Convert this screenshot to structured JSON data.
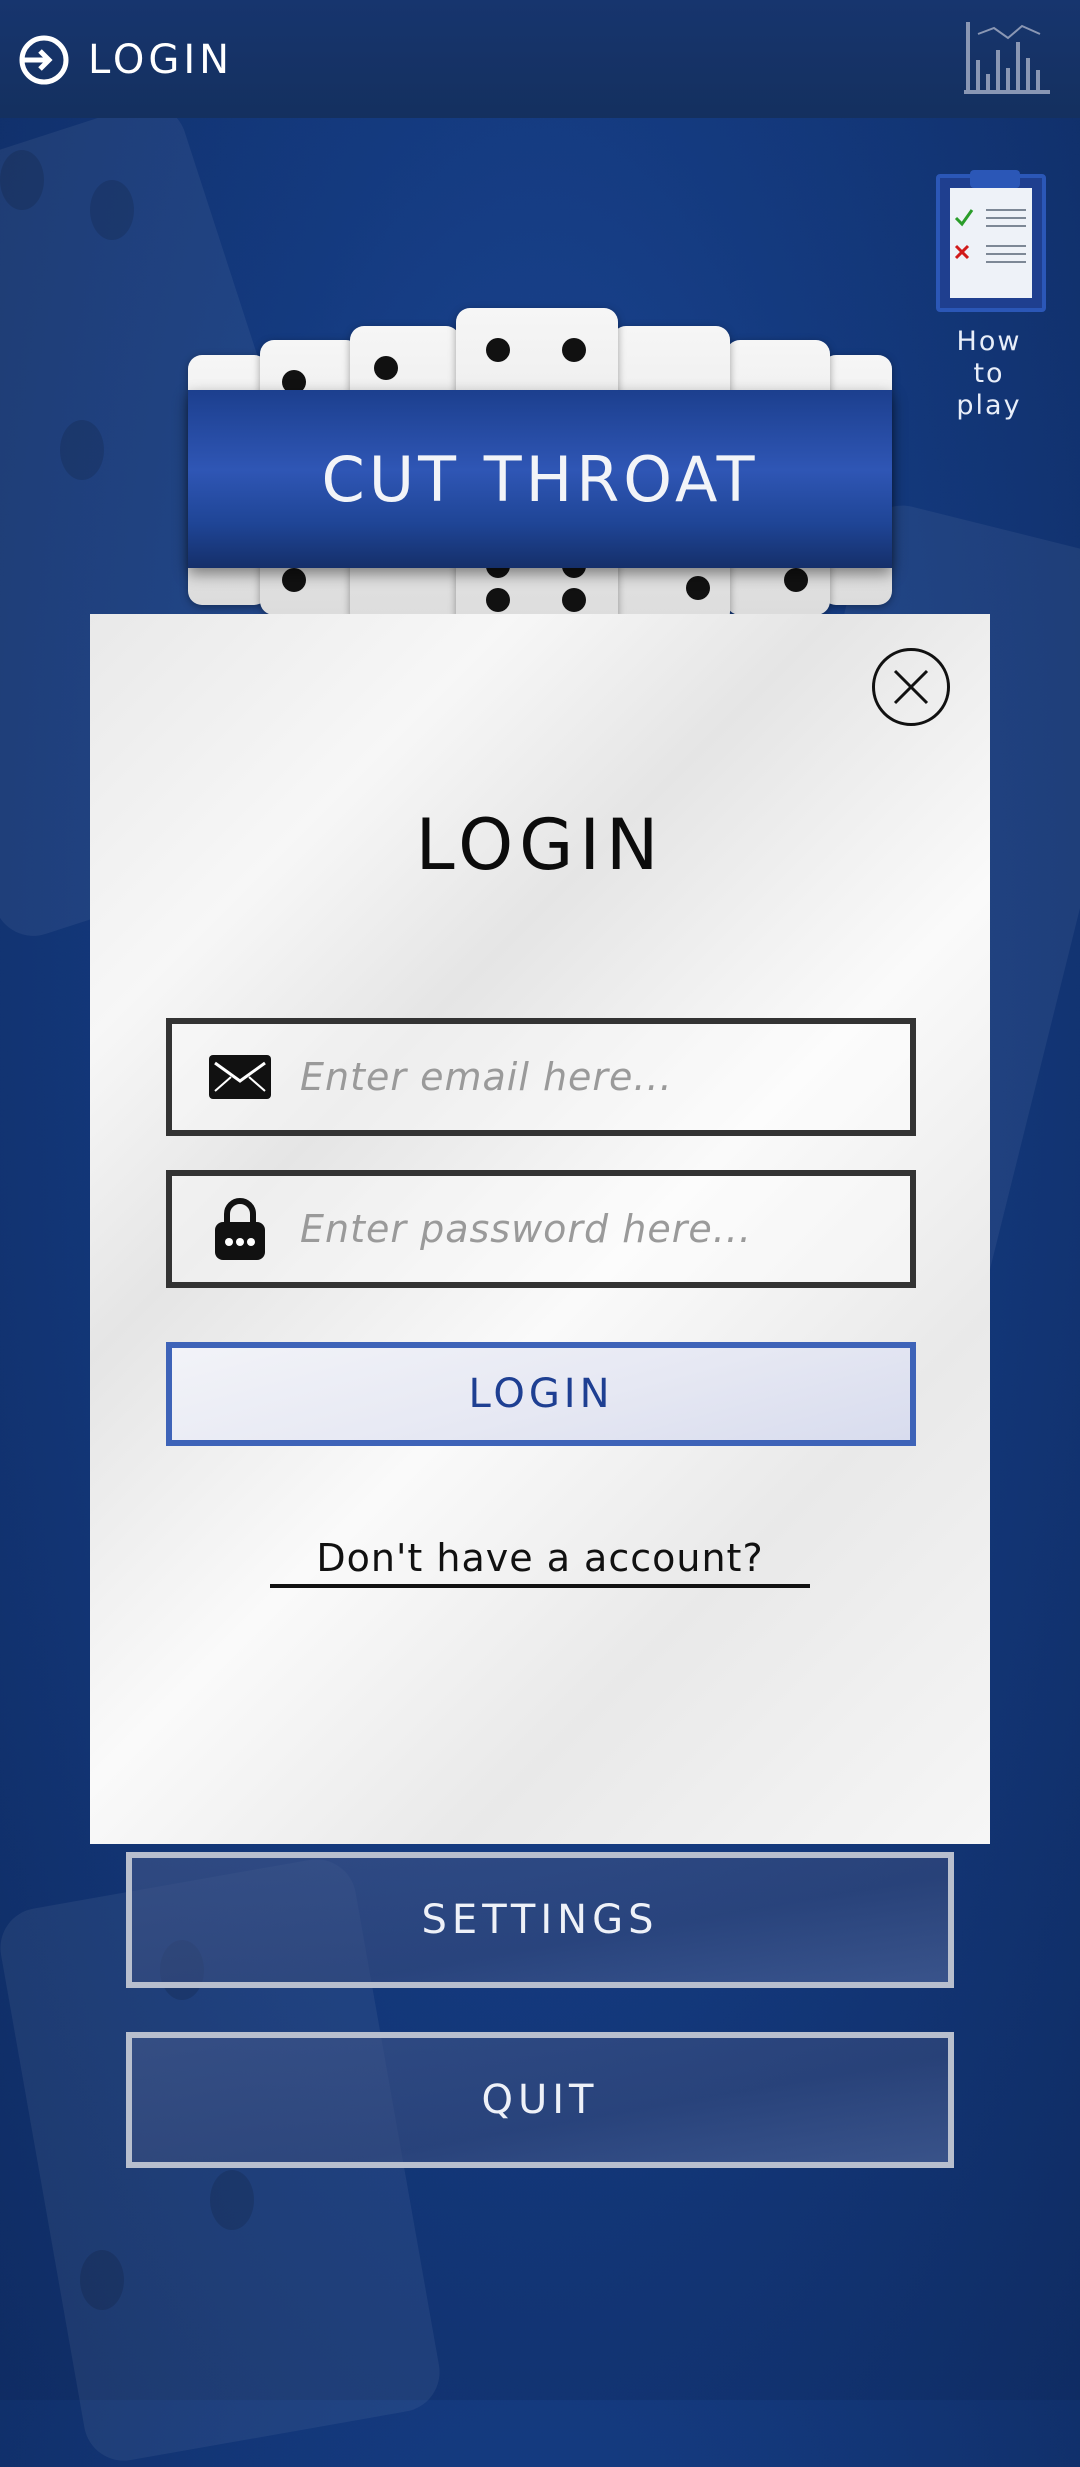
{
  "header": {
    "login_label": "LOGIN"
  },
  "howto": {
    "label_line1": "How",
    "label_line2": "to",
    "label_line3": "play"
  },
  "banner": {
    "title": "CUT THROAT"
  },
  "dialog": {
    "title": "LOGIN",
    "email_placeholder": "Enter email here...",
    "password_placeholder": "Enter password here...",
    "login_button": "LOGIN",
    "signup_link": "Don't have a account?"
  },
  "menu": {
    "settings_label": "SETTINGS",
    "quit_label": "QUIT"
  },
  "colors": {
    "accent": "#3e63b8",
    "background": "#143a7f",
    "check": "#2a9d2a",
    "cross": "#d11a1a"
  }
}
